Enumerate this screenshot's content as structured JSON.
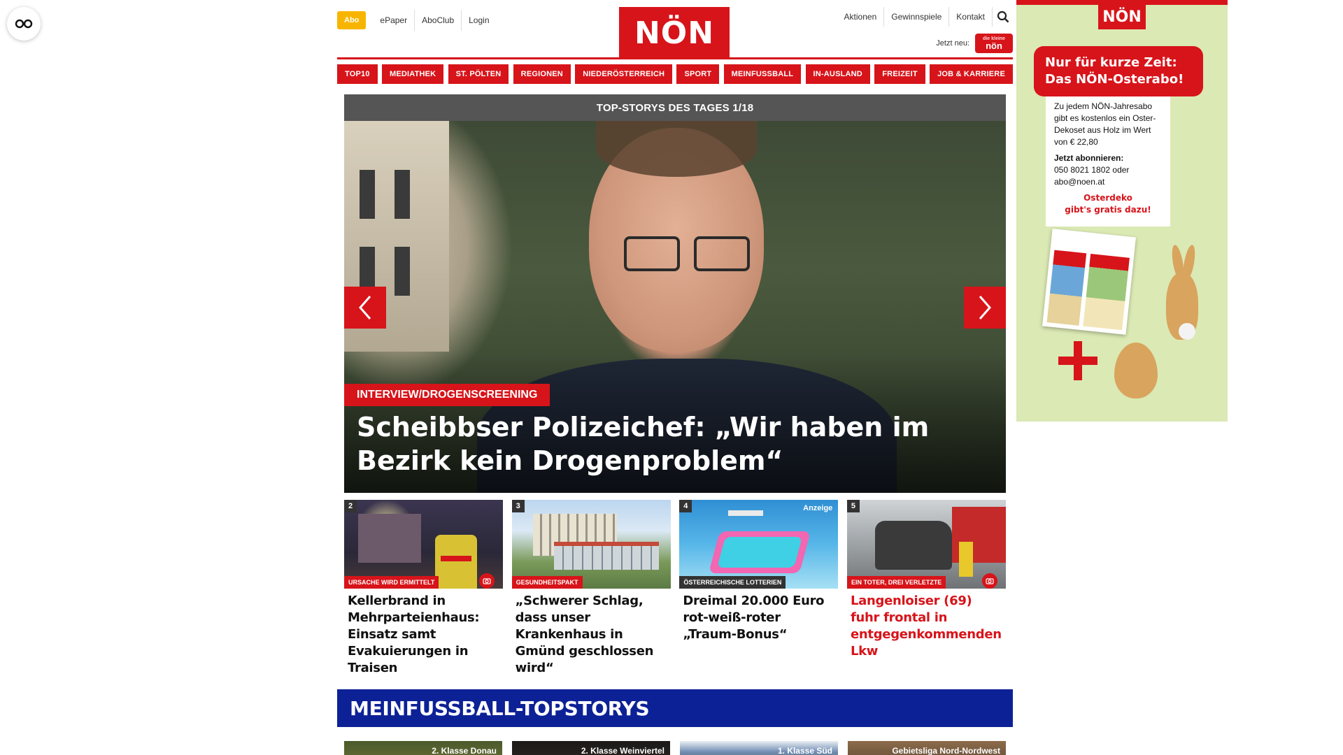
{
  "header": {
    "top_links": [
      "Abo",
      "ePaper",
      "AboClub",
      "Login"
    ],
    "logo": "NÖN",
    "right_links": [
      "Aktionen",
      "Gewinnspiele",
      "Kontakt"
    ],
    "jetzt_neu_label": "Jetzt neu:",
    "kinder_badge_small": "die kleine",
    "kinder_badge": "nön"
  },
  "nav": {
    "items": [
      "TOP10",
      "MEDIATHEK",
      "ST. PÖLTEN",
      "REGIONEN",
      "NIEDERÖSTERREICH",
      "SPORT",
      "MEINFUSSBALL",
      "IN-AUSLAND",
      "FREIZEIT",
      "JOB & KARRIERE"
    ]
  },
  "hero": {
    "bar_title": "TOP-STORYS DES TAGES 1/18",
    "kicker": "INTERVIEW/DROGENSCREENING",
    "title": "Scheibbser Polizeichef: „Wir haben im Bezirk kein Drogenproblem“"
  },
  "cards": [
    {
      "num": "2",
      "kicker": "URSACHE WIRD ERMITTELT",
      "title": "Kellerbrand in Mehrparteienhaus: Einsatz samt Evakuierungen in Traisen",
      "has_camera": true
    },
    {
      "num": "3",
      "kicker": "GESUNDHEITSPAKT",
      "title": "„Schwerer Schlag, dass unser Krankenhaus in Gmünd geschlossen wird“",
      "has_camera": false
    },
    {
      "num": "4",
      "kicker": "ÖSTERREICHISCHE LOTTERIEN",
      "title": "Dreimal 20.000 Euro rot-weiß-roter „Traum-Bonus“",
      "badge": "Anzeige"
    },
    {
      "num": "5",
      "kicker": "EIN TOTER, DREI VERLETZTE",
      "title": "Langenloiser (69) fuhr frontal in entgegenkommenden Lkw",
      "has_camera": true
    }
  ],
  "section": {
    "title": "MEINFUSSBALL-TOPSTORYS",
    "thumbs": [
      "2. Klasse Donau",
      "2. Klasse Weinviertel",
      "1. Klasse Süd",
      "Gebietsliga Nord-Nordwest"
    ]
  },
  "ad": {
    "logo": "NÖN",
    "bubble_line1": "Nur für kurze Zeit:",
    "bubble_line2": "Das NÖN-Osterabo!",
    "body": "Zu jedem NÖN-Jahresabo gibt es kostenlos ein Oster-Dekoset aus Holz im Wert von € 22,80",
    "cta_label": "Jetzt abonnieren:",
    "cta_contact": "050 8021 1802 oder abo@noen.at",
    "highlight_line1": "Osterdeko",
    "highlight_line2": "gibt's gratis dazu!"
  },
  "colors": {
    "brand_red": "#d7141a",
    "abo_yellow": "#f7b500",
    "section_blue": "#0d2196"
  }
}
